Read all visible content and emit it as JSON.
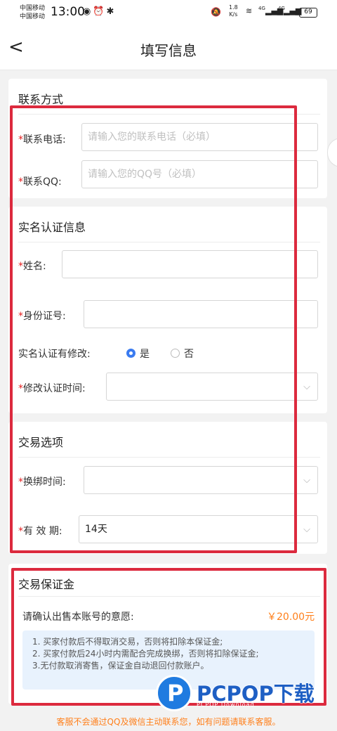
{
  "status_bar": {
    "carrier_1": "中国移动",
    "carrier_2": "中国移动",
    "time": "13:00",
    "net_speed_value": "1.8",
    "net_speed_unit": "K/s",
    "signal_label_1": "4G",
    "signal_label_2": "4G",
    "battery": "69"
  },
  "nav": {
    "back_glyph": "<",
    "title": "填写信息"
  },
  "contact": {
    "title": "联系方式",
    "required_mark": "*",
    "phone_label": "联系电话:",
    "phone_placeholder": "请输入您的联系电话（必填）",
    "qq_label": "联系QQ:",
    "qq_placeholder": "请输入您的QQ号（必填）"
  },
  "realname": {
    "title": "实名认证信息",
    "name_label": "姓名:",
    "name_value": "",
    "id_label": "身份证号:",
    "id_value": "",
    "modified_label": "实名认证有修改:",
    "option_yes": "是",
    "option_no": "否",
    "selected": "是",
    "modify_time_label": "修改认证时间:",
    "modify_time_value": ""
  },
  "trade": {
    "title": "交易选项",
    "rebind_label": "换绑时间:",
    "rebind_value": "",
    "period_label": "有 效 期:",
    "period_value": "14天"
  },
  "deposit": {
    "title": "交易保证金",
    "confirm_text": "请确认出售本账号的意愿:",
    "amount": "￥20.00元",
    "notes": [
      "1. 买家付款后不得取消交易，否则将扣除本保证金;",
      "2. 买家付款后24小时内需配合完成换绑，否则将扣除保证金;",
      "3.无付款取消寄售，保证金自动退回付款账户。"
    ]
  },
  "footer": {
    "notice": "客服不会通过QQ及微信主动联系您，如有问题请联系客服。"
  },
  "watermark": {
    "logo_letter": "P",
    "text": "PCPOP下载",
    "sub": "PCPOP Download"
  },
  "colors": {
    "accent_blue": "#3a7bf0",
    "highlight_red": "#dc2a3e",
    "price_orange": "#ff7f1a",
    "required_red": "#e52020"
  }
}
